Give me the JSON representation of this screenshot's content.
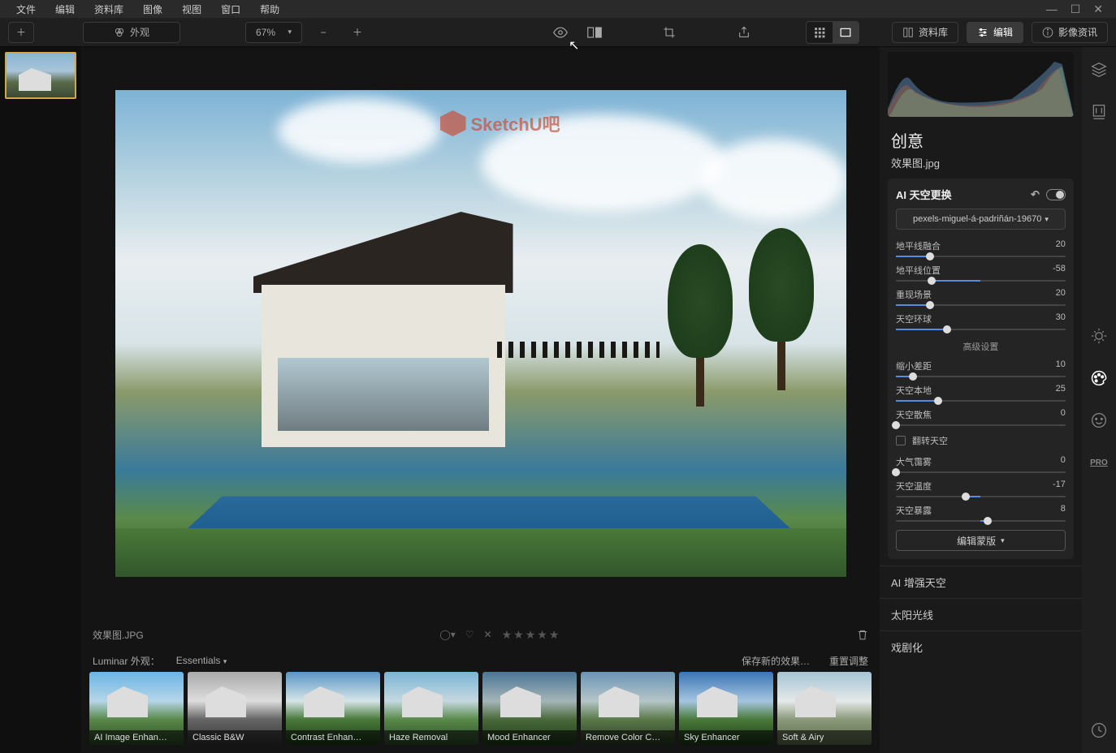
{
  "menu": {
    "file": "文件",
    "edit": "编辑",
    "library": "资料库",
    "image": "图像",
    "view": "视图",
    "window": "窗口",
    "help": "帮助"
  },
  "toolbar": {
    "appearance": "外观",
    "zoom": "67%",
    "library_btn": "资料库",
    "edit_btn": "编辑",
    "info_btn": "影像资讯"
  },
  "watermark": "SketchU吧",
  "info": {
    "filename": "效果图.JPG"
  },
  "presets_bar": {
    "title": "Luminar 外观：",
    "category": "Essentials",
    "save_new": "保存新的效果…",
    "reset": "重置调整"
  },
  "presets": [
    {
      "label": "AI Image Enhan…",
      "bg": "linear-gradient(180deg,#6ab5e5 0%,#b5d5e8 40%,#5a8a4a 65%,#2a4a25 100%)"
    },
    {
      "label": "Classic B&W",
      "bg": "linear-gradient(180deg,#aaa 0%,#ddd 40%,#666 65%,#333 100%)"
    },
    {
      "label": "Contrast Enhan…",
      "bg": "linear-gradient(180deg,#5a95c5 0%,#d5e5e8 40%,#4a7a3a 65%,#1a3a18 100%)"
    },
    {
      "label": "Haze Removal",
      "bg": "linear-gradient(180deg,#7ab5d5 0%,#c5d8e0 40%,#5a8a4a 65%,#2a4a28 100%)"
    },
    {
      "label": "Mood Enhancer",
      "bg": "linear-gradient(180deg,#4a7595 0%,#a5b5b8 40%,#4a6a3a 65%,#1a3a18 100%)"
    },
    {
      "label": "Remove Color C…",
      "bg": "linear-gradient(180deg,#6a95b5 0%,#b5c5c8 40%,#5a7a4a 65%,#2a3a25 100%)"
    },
    {
      "label": "Sky Enhancer",
      "bg": "linear-gradient(180deg,#3a75b5 0%,#a5c5e0 40%,#4a7a3a 65%,#1a3a18 100%)"
    },
    {
      "label": "Soft & Airy",
      "bg": "linear-gradient(180deg,#a5c5d5 0%,#e5e8e8 40%,#8a9a7a 65%,#5a6a48 100%)"
    }
  ],
  "panel": {
    "title": "创意",
    "filename": "效果图.jpg",
    "tool_name": "AI 天空更换",
    "sky_preset": "pexels-miguel-á-padriñán-19670",
    "advanced": "高级设置",
    "mask_btn": "编辑蒙版",
    "sliders": [
      {
        "label": "地平线融合",
        "value": 20,
        "pos": 20
      },
      {
        "label": "地平线位置",
        "value": -58,
        "pos": 21,
        "fill_start": 21,
        "fill_end": 50
      },
      {
        "label": "重现场景",
        "value": 20,
        "pos": 20
      },
      {
        "label": "天空环球",
        "value": 30,
        "pos": 30
      }
    ],
    "sliders2": [
      {
        "label": "缩小差距",
        "value": 10,
        "pos": 10
      },
      {
        "label": "天空本地",
        "value": 25,
        "pos": 25
      },
      {
        "label": "天空散焦",
        "value": 0,
        "pos": 0
      }
    ],
    "flip_sky": "翻转天空",
    "sliders3": [
      {
        "label": "大气霭雾",
        "value": 0,
        "pos": 0
      },
      {
        "label": "天空温度",
        "value": -17,
        "pos": 41,
        "fill_start": 41,
        "fill_end": 50
      },
      {
        "label": "天空暴露",
        "value": 8,
        "pos": 54,
        "fill_start": 50,
        "fill_end": 54
      }
    ],
    "collapse": [
      "AI 增强天空",
      "太阳光线",
      "戏剧化"
    ]
  },
  "side_pro": "PRO"
}
